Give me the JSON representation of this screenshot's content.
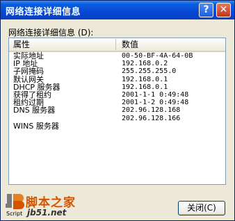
{
  "window": {
    "title": "网络连接详细信息",
    "help_label": "?",
    "close_label": "✕"
  },
  "details": {
    "label": "网络连接详细信息 (D):",
    "columns": [
      "属性",
      "数值"
    ],
    "rows": [
      {
        "property": "实际地址",
        "value": "00-50-BF-4A-64-0B"
      },
      {
        "property": "IP 地址",
        "value": "192.168.0.2"
      },
      {
        "property": "子网掩码",
        "value": "255.255.255.0"
      },
      {
        "property": "默认网关",
        "value": "192.168.0.1"
      },
      {
        "property": "DHCP 服务器",
        "value": "192.168.0.1"
      },
      {
        "property": "获得了租约",
        "value": "2001-1-1 0:49:48"
      },
      {
        "property": "租约过期",
        "value": "2001-1-2 0:49:48"
      },
      {
        "property": "DNS 服务器",
        "value": "202.96.128.168"
      },
      {
        "property": "",
        "value": "202.96.128.166"
      },
      {
        "property": "WINS 服务器",
        "value": ""
      }
    ]
  },
  "watermark": {
    "brand": "脚本之家",
    "domain": "jb51.net",
    "script": "Script"
  },
  "buttons": {
    "close": "关闭(C)"
  },
  "colors": {
    "titlebar": "#0548d4",
    "face": "#ece9d8",
    "close_red": "#c2351a",
    "brand_orange": "#d35400"
  }
}
